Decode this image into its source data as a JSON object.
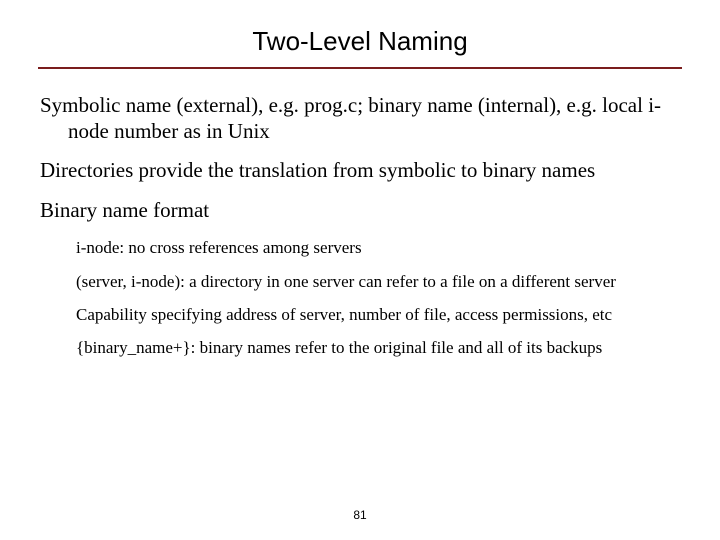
{
  "title": "Two-Level Naming",
  "bullets_level1": {
    "b0": "Symbolic name (external), e.g. prog.c; binary name (internal), e.g. local i-node number as in Unix",
    "b1": "Directories provide the translation from symbolic to binary names",
    "b2": "Binary name format"
  },
  "bullets_level2": {
    "s0": "i-node: no cross references among servers",
    "s1": "(server, i-node): a directory in one server can refer to a file on a different server",
    "s2": "Capability specifying address of server, number of file, access permissions, etc",
    "s3": "{binary_name+}: binary names refer to the original file and all of its backups"
  },
  "page_number": "81"
}
